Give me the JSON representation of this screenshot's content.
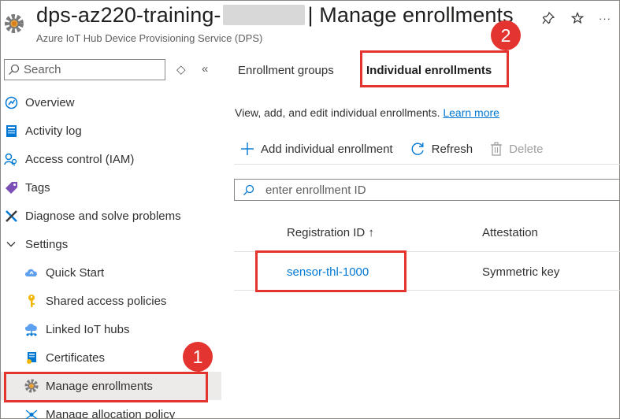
{
  "header": {
    "title_prefix": "dps-az220-training-",
    "title_separator": "|",
    "title_page": "Manage enrollments",
    "subtitle": "Azure IoT Hub Device Provisioning Service (DPS)",
    "pin_icon": "pin-icon",
    "star_icon": "star-icon",
    "more_label": "···"
  },
  "badges": {
    "one": "1",
    "two": "2"
  },
  "nav": {
    "search_placeholder": "Search",
    "expand_glyph": "◇",
    "collapse_glyph": "«",
    "items": [
      {
        "label": "Overview",
        "icon": "overview-icon"
      },
      {
        "label": "Activity log",
        "icon": "activity-log-icon"
      },
      {
        "label": "Access control (IAM)",
        "icon": "access-control-icon"
      },
      {
        "label": "Tags",
        "icon": "tag-icon"
      },
      {
        "label": "Diagnose and solve problems",
        "icon": "wrench-icon"
      },
      {
        "label": "Settings",
        "icon": "chevron-down-icon"
      },
      {
        "label": "Quick Start",
        "icon": "cloud-icon"
      },
      {
        "label": "Shared access policies",
        "icon": "key-icon"
      },
      {
        "label": "Linked IoT hubs",
        "icon": "linked-hub-icon"
      },
      {
        "label": "Certificates",
        "icon": "certificate-icon"
      },
      {
        "label": "Manage enrollments",
        "icon": "gear-icon"
      },
      {
        "label": "Manage allocation policy",
        "icon": "allocation-icon"
      }
    ]
  },
  "main": {
    "tabs": [
      {
        "label": "Enrollment groups"
      },
      {
        "label": "Individual enrollments"
      }
    ],
    "description": "View, add, and edit individual enrollments.",
    "learn_more": "Learn more",
    "toolbar": {
      "add_label": "Add individual enrollment",
      "refresh_label": "Refresh",
      "delete_label": "Delete"
    },
    "filter_placeholder": "enter enrollment ID",
    "table": {
      "columns": [
        "Registration ID ↑",
        "Attestation"
      ],
      "rows": [
        {
          "registration_id": "sensor-thl-1000",
          "attestation": "Symmetric key"
        }
      ]
    }
  },
  "colors": {
    "accent": "#0078d4",
    "callout": "#e3342f",
    "active_bg": "#edebe9"
  }
}
